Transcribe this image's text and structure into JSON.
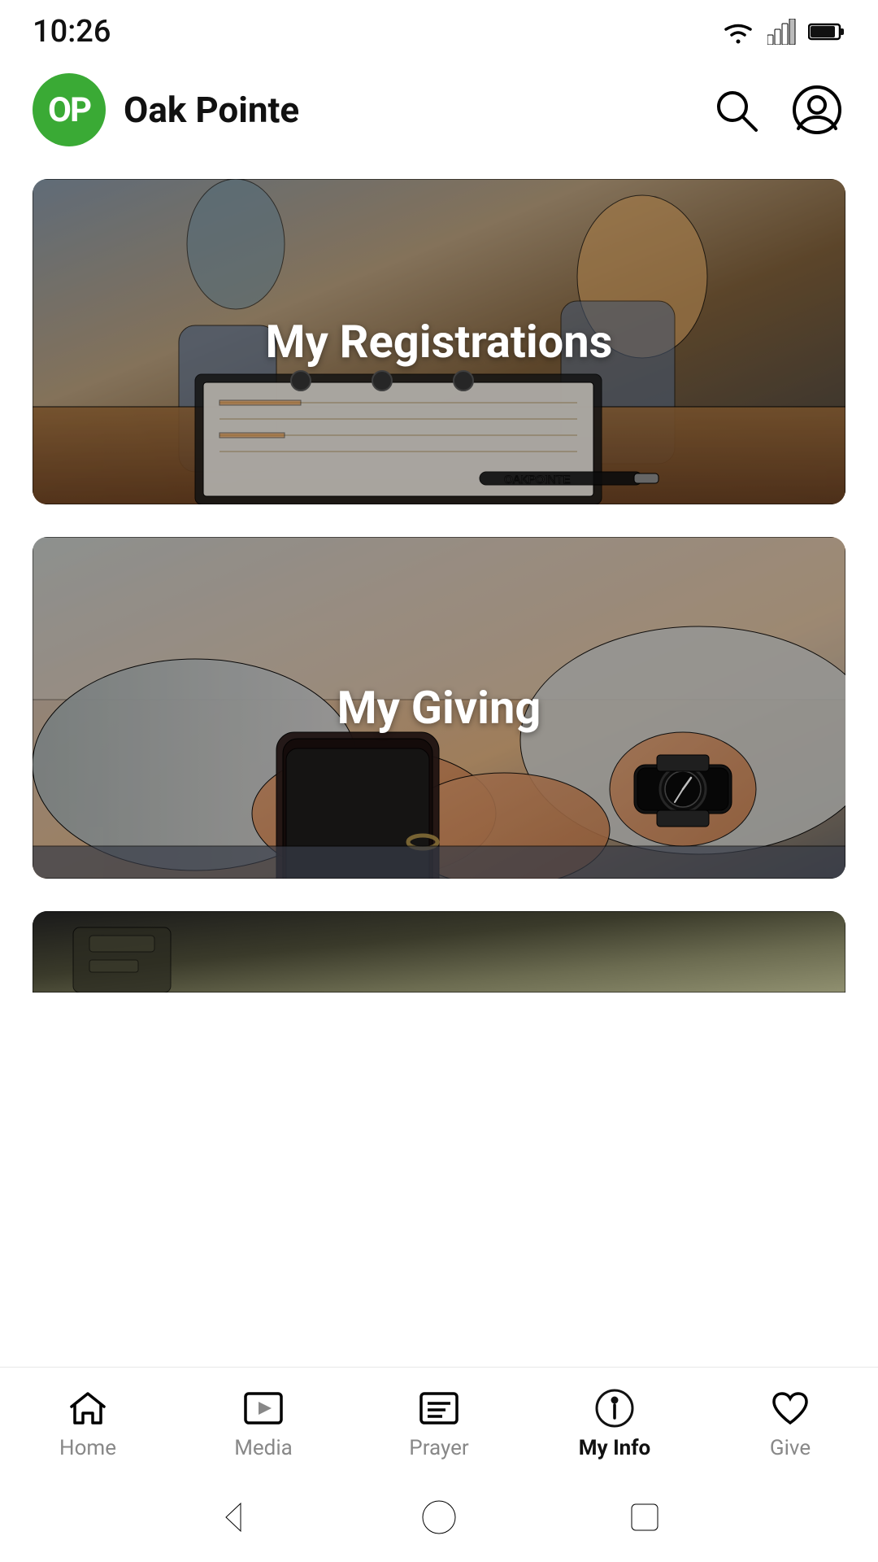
{
  "statusBar": {
    "time": "10:26"
  },
  "header": {
    "logo": {
      "initials": "OP",
      "bgColor": "#3aaa35"
    },
    "appName": "Oak Pointe",
    "searchIcon": "search-icon",
    "profileIcon": "profile-icon"
  },
  "cards": [
    {
      "id": "registrations",
      "title": "My Registrations",
      "altText": "Binder with papers and pen on table"
    },
    {
      "id": "giving",
      "title": "My Giving",
      "altText": "Person holding phone with watch"
    },
    {
      "id": "partial",
      "title": "",
      "altText": "Partial card"
    }
  ],
  "bottomNav": {
    "items": [
      {
        "id": "home",
        "label": "Home",
        "icon": "home-icon",
        "active": false
      },
      {
        "id": "media",
        "label": "Media",
        "icon": "media-icon",
        "active": false
      },
      {
        "id": "prayer",
        "label": "Prayer",
        "icon": "prayer-icon",
        "active": false
      },
      {
        "id": "myinfo",
        "label": "My Info",
        "icon": "myinfo-icon",
        "active": true
      },
      {
        "id": "give",
        "label": "Give",
        "icon": "give-icon",
        "active": false
      }
    ]
  },
  "systemNav": {
    "backIcon": "back-arrow-icon",
    "homeIcon": "circle-home-icon",
    "recentIcon": "square-recent-icon"
  }
}
